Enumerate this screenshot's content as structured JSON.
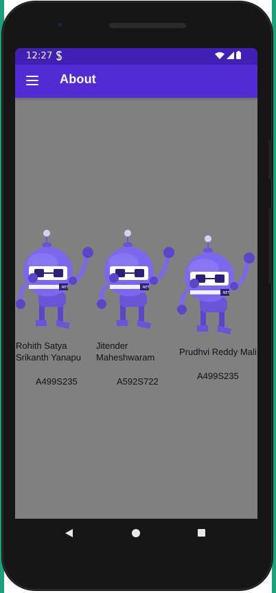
{
  "status_bar": {
    "time": "12:27",
    "notification_icon": "s-notification-icon",
    "icons": [
      "wifi-icon",
      "signal-icon",
      "battery-icon"
    ]
  },
  "app_bar": {
    "menu_icon": "hamburger-menu-icon",
    "title": "About"
  },
  "members": [
    {
      "name_line1": "Rohith Satya",
      "name_line2": "Srikanth Yanapu",
      "id": "A499S235",
      "image": "dotnet-bot-icon"
    },
    {
      "name_line1": "Jitender",
      "name_line2": "Maheshwaram",
      "id": "A592S722",
      "image": "dotnet-bot-icon"
    },
    {
      "name_line1": "Prudhvi Reddy Mali",
      "name_line2": "",
      "id": "A499S235",
      "image": "dotnet-bot-icon"
    }
  ],
  "nav_bar": {
    "back_icon": "back-icon",
    "home_icon": "home-icon",
    "recents_icon": "recents-icon"
  },
  "colors": {
    "status_bar": "#3f1fb4",
    "app_bar": "#512bd4",
    "content_bg": "#808080",
    "bot_primary": "#7b68ee"
  }
}
